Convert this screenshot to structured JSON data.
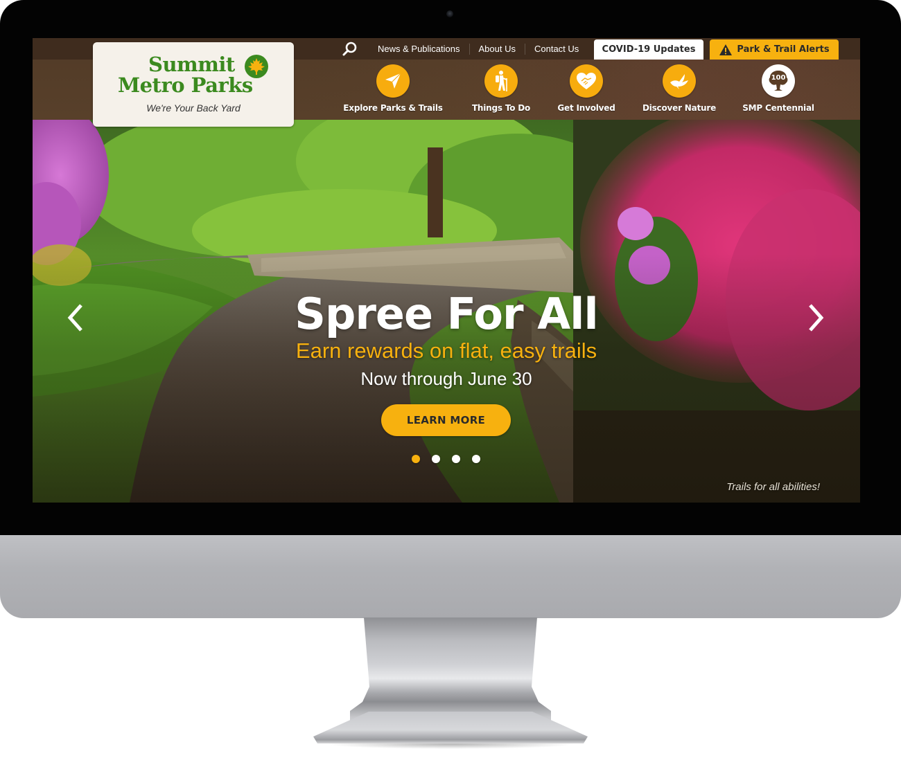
{
  "site": {
    "name_line1": "Summit",
    "name_line2": "Metro Parks",
    "tagline": "We're Your Back Yard"
  },
  "utility_nav": {
    "search_icon": "search-icon",
    "links": [
      {
        "label": "News & Publications"
      },
      {
        "label": "About Us"
      },
      {
        "label": "Contact Us"
      }
    ],
    "covid_button": "COVID-19 Updates",
    "alerts_button": "Park & Trail Alerts",
    "alerts_icon": "warning-icon"
  },
  "main_nav": [
    {
      "label": "Explore Parks & Trails",
      "icon": "location-arrow-icon"
    },
    {
      "label": "Things To Do",
      "icon": "hiker-icon"
    },
    {
      "label": "Get Involved",
      "icon": "heart-handshake-icon"
    },
    {
      "label": "Discover Nature",
      "icon": "bird-icon"
    },
    {
      "label": "SMP Centennial",
      "icon": "centennial-tree-icon",
      "badge_text": "100"
    }
  ],
  "hero": {
    "title": "Spree For All",
    "subtitle": "Earn rewards on flat, easy trails",
    "dates": "Now through June 30",
    "cta_label": "LEARN MORE",
    "caption": "Trails for all abilities!",
    "slide_count": 4,
    "active_slide": 1
  },
  "colors": {
    "brand_green": "#3b8a1f",
    "accent_yellow": "#f7b10f",
    "header_brown": "#58402a",
    "logo_bg": "#f5f1ea"
  }
}
